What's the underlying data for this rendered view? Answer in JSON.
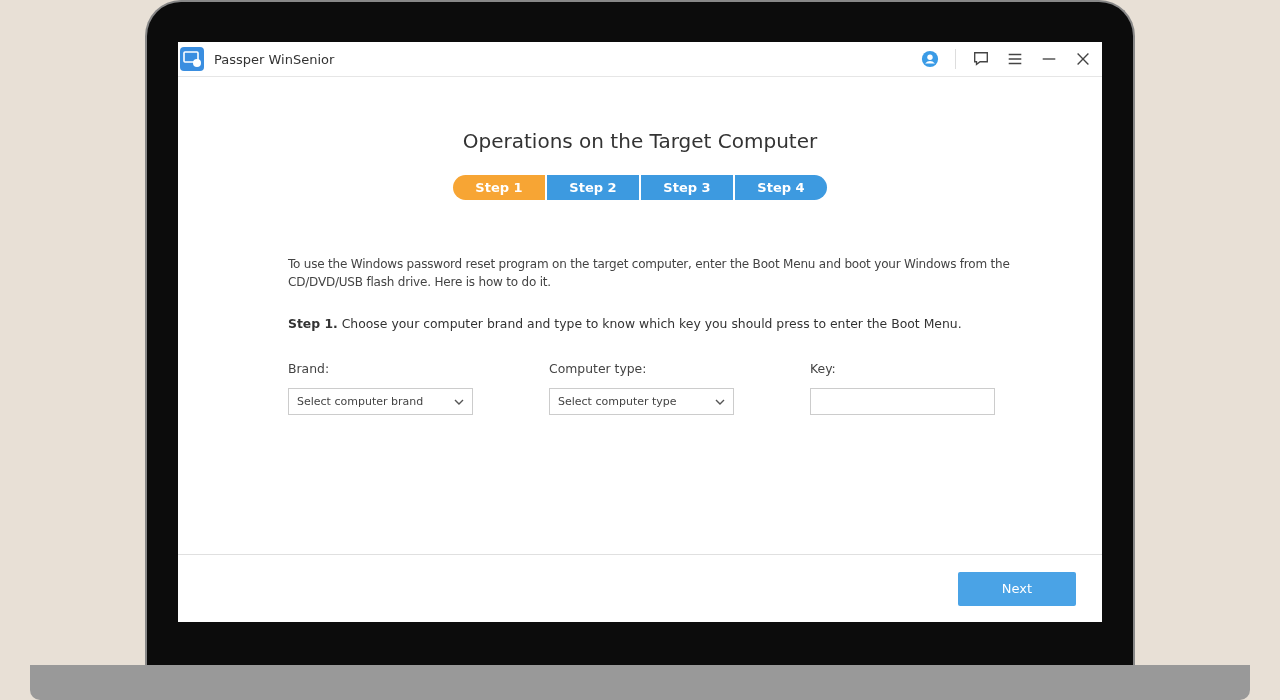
{
  "window": {
    "title": "Passper WinSenior"
  },
  "heading": "Operations on the Target Computer",
  "steps": [
    {
      "label": "Step 1",
      "selected": true
    },
    {
      "label": "Step 2",
      "selected": false
    },
    {
      "label": "Step 3",
      "selected": false
    },
    {
      "label": "Step 4",
      "selected": false
    }
  ],
  "intro": "To use the Windows password reset program on the target computer, enter the Boot Menu and boot your Windows from the CD/DVD/USB flash drive. Here is how to do it.",
  "instruction": "**Step 1.** Choose your computer brand and type to know which key you should press to enter the Boot Menu.",
  "fields": [
    {
      "kind": "dropdown",
      "label": "Brand:",
      "placeholder": "Select computer brand"
    },
    {
      "kind": "dropdown",
      "label": "Computer type:",
      "placeholder": "Select computer type"
    },
    {
      "kind": "text",
      "label": "Key:"
    }
  ],
  "next_button": "Next"
}
